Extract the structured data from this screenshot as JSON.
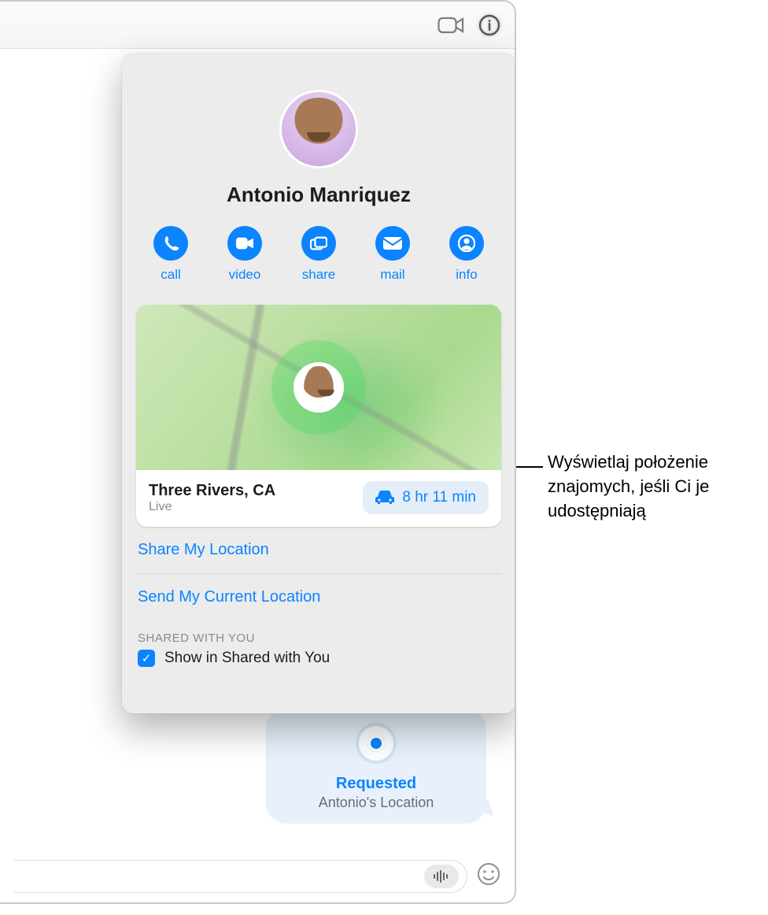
{
  "titlebar": {
    "facetime_icon": "facetime",
    "info_icon": "info"
  },
  "contact": {
    "name": "Antonio Manriquez"
  },
  "actions": {
    "call": "call",
    "video": "video",
    "share": "share",
    "mail": "mail",
    "info": "info"
  },
  "location": {
    "place": "Three Rivers, CA",
    "status": "Live",
    "eta": "8 hr 11 min"
  },
  "links": {
    "share_my_location": "Share My Location",
    "send_current_location": "Send My Current Location"
  },
  "shared_with_you": {
    "header": "SHARED WITH YOU",
    "show_label": "Show in Shared with You",
    "checked": true
  },
  "message": {
    "title": "Requested",
    "subtitle": "Antonio's Location"
  },
  "callout": {
    "text": "Wyświetlaj położenie znajomych, jeśli Ci je udostępniają"
  }
}
